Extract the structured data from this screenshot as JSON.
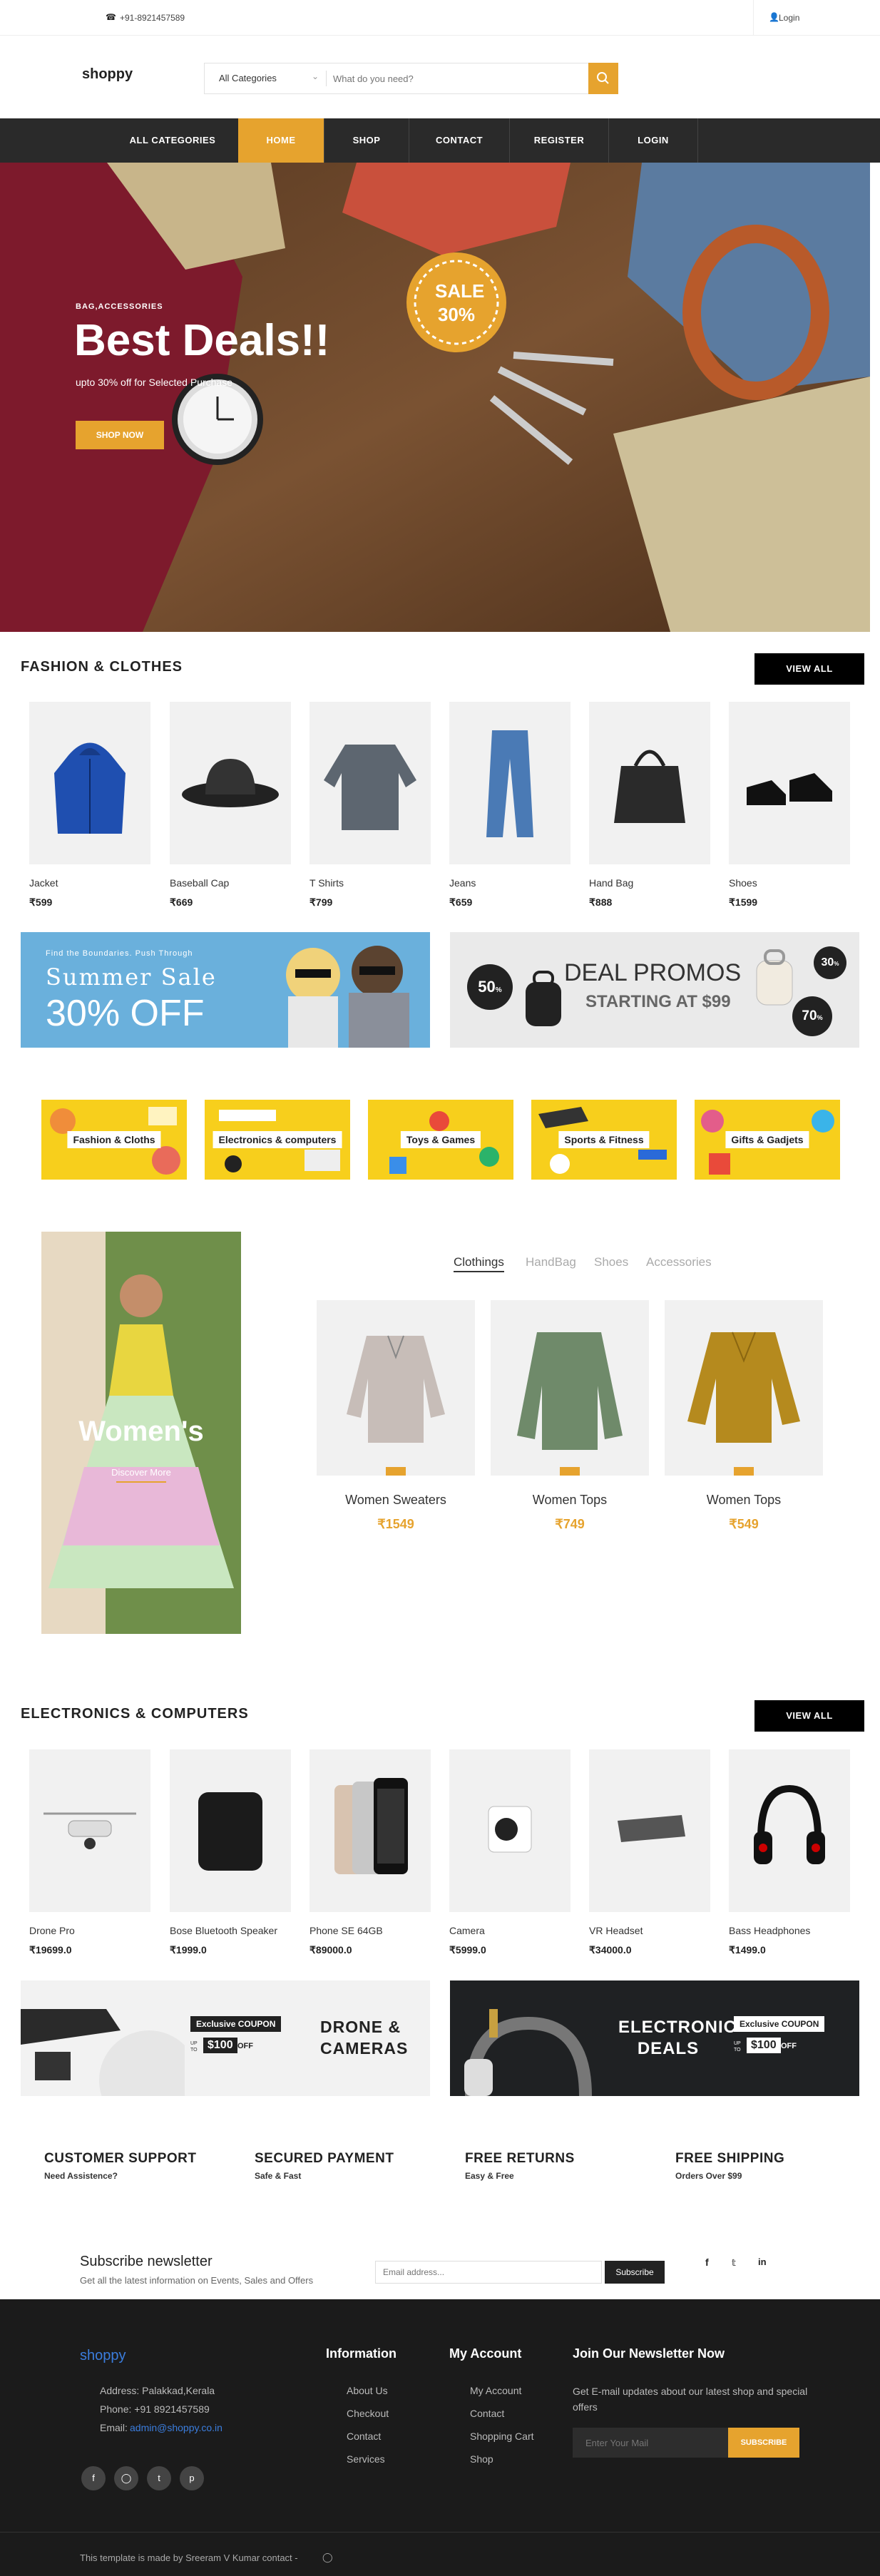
{
  "topbar": {
    "phone": "+91-8921457589",
    "login": "Login"
  },
  "header": {
    "logo": "shoppy",
    "category_select": "All Categories",
    "search_placeholder": "What do you need?"
  },
  "nav": {
    "items": [
      "ALL CATEGORIES",
      "HOME",
      "SHOP",
      "CONTACT",
      "REGISTER",
      "LOGIN"
    ]
  },
  "hero": {
    "kicker": "BAG,ACCESSORIES",
    "title": "Best Deals!!",
    "subtitle": "upto 30% off for Selected Purchase",
    "button": "SHOP NOW",
    "sale_line1": "SALE",
    "sale_line2": "30%"
  },
  "fashion": {
    "title": "FASHION & CLOTHES",
    "view_all": "VIEW ALL",
    "products": [
      {
        "name": "Jacket",
        "price": "₹599"
      },
      {
        "name": "Baseball Cap",
        "price": "₹669"
      },
      {
        "name": "T Shirts",
        "price": "₹799"
      },
      {
        "name": "Jeans",
        "price": "₹659"
      },
      {
        "name": "Hand Bag",
        "price": "₹888"
      },
      {
        "name": "Shoes",
        "price": "₹1599"
      }
    ]
  },
  "banner_summer": {
    "kicker": "Find the Boundaries. Push Through",
    "title": "Summer Sale",
    "offer": "30% OFF"
  },
  "banner_deal": {
    "title": "DEAL PROMOS",
    "subtitle": "STARTING AT $99",
    "badge1": "50",
    "badge2": "30",
    "badge3": "70",
    "percent": "%"
  },
  "categories": [
    "Fashion & Cloths",
    "Electronics & computers",
    "Toys & Games",
    "Sports & Fitness",
    "Gifts & Gadjets"
  ],
  "women": {
    "promo_title": "Women's",
    "promo_link": "Discover More",
    "tabs": [
      "Clothings",
      "HandBag",
      "Shoes",
      "Accessories"
    ],
    "products": [
      {
        "name": "Women Sweaters",
        "price": "₹1549"
      },
      {
        "name": "Women Tops",
        "price": "₹749"
      },
      {
        "name": "Women Tops",
        "price": "₹549"
      }
    ]
  },
  "electronics": {
    "title": "ELECTRONICS & COMPUTERS",
    "view_all": "VIEW ALL",
    "products": [
      {
        "name": "Drone Pro",
        "price": "₹19699.0"
      },
      {
        "name": "Bose Bluetooth Speaker",
        "price": "₹1999.0"
      },
      {
        "name": "Phone SE 64GB",
        "price": "₹89000.0"
      },
      {
        "name": "Camera",
        "price": "₹5999.0"
      },
      {
        "name": "VR Headset",
        "price": "₹34000.0"
      },
      {
        "name": "Bass Headphones",
        "price": "₹1499.0"
      }
    ]
  },
  "coupon_drone": {
    "coupon": "Exclusive COUPON",
    "amount": "$100",
    "off": "OFF",
    "upto": "UP TO",
    "line1": "DRONE &",
    "line2": "CAMERAS"
  },
  "coupon_electronic": {
    "coupon": "Exclusive COUPON",
    "amount": "$100",
    "off": "OFF",
    "upto": "UP TO",
    "line1": "ELECTRONIC",
    "line2": "DEALS"
  },
  "features": [
    {
      "title": "CUSTOMER SUPPORT",
      "sub": "Need Assistence?"
    },
    {
      "title": "SECURED PAYMENT",
      "sub": "Safe & Fast"
    },
    {
      "title": "FREE RETURNS",
      "sub": "Easy & Free"
    },
    {
      "title": "FREE SHIPPING",
      "sub": "Orders Over $99"
    }
  ],
  "newsletter": {
    "title": "Subscribe newsletter",
    "subtitle": "Get all the latest information on Events, Sales and Offers",
    "placeholder": "Email address...",
    "button": "Subscribe"
  },
  "footer": {
    "logo": "shoppy",
    "address": "Address: Palakkad,Kerala",
    "phone": "Phone: +91 8921457589",
    "email_label": "Email:",
    "email": "admin@shoppy.co.in",
    "info_title": "Information",
    "info_links": [
      "About Us",
      "Checkout",
      "Contact",
      "Services"
    ],
    "account_title": "My Account",
    "account_links": [
      "My Account",
      "Contact",
      "Shopping Cart",
      "Shop"
    ],
    "join_title": "Join Our Newsletter Now",
    "join_text": "Get E-mail updates about our latest shop and special offers",
    "join_placeholder": "Enter Your Mail",
    "join_button": "SUBSCRIBE",
    "credit": "This template is made by Sreeram V Kumar contact -"
  },
  "colors": {
    "accent": "#e6a32e",
    "dark": "#2a2a2a",
    "footer": "#1b1b1b",
    "link_blue": "#3b7ddd"
  }
}
